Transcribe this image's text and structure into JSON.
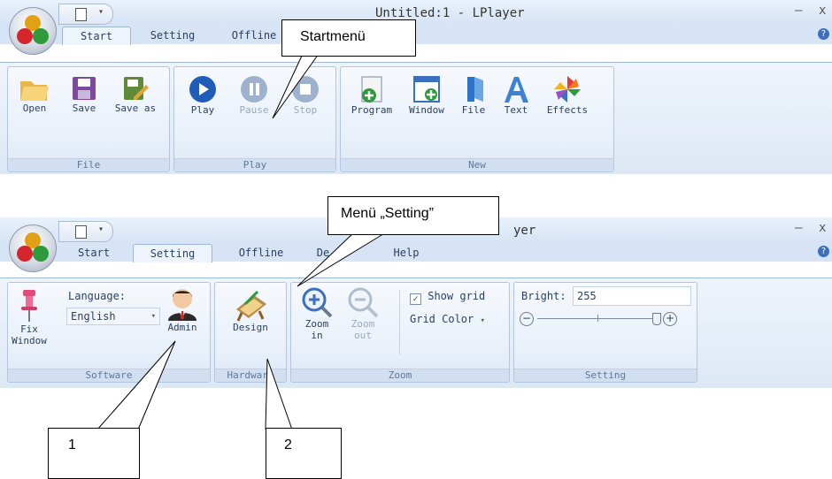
{
  "window1": {
    "title": "Untitled:1 - LPlayer",
    "tabs": [
      "Start",
      "Setting",
      "Offline"
    ],
    "groups": {
      "file": {
        "caption": "File",
        "buttons": [
          "Open",
          "Save",
          "Save as"
        ]
      },
      "play": {
        "caption": "Play",
        "buttons": [
          "Play",
          "Pause",
          "Stop"
        ]
      },
      "new": {
        "caption": "New",
        "buttons": [
          "Program",
          "Window",
          "File",
          "Text",
          "Effects"
        ]
      }
    }
  },
  "window2": {
    "title": "yer",
    "tabs": [
      "Start",
      "Setting",
      "Offline",
      "De",
      "Help"
    ],
    "software": {
      "caption": "Software",
      "fix_window": "Fix Window",
      "language_label": "Language:",
      "language_value": "English",
      "admin": "Admin"
    },
    "hardware": {
      "caption": "Hardware",
      "design": "Design"
    },
    "zoom": {
      "caption": "Zoom",
      "zoom_in": "Zoom in",
      "zoom_out": "Zoom out",
      "show_grid": "Show grid",
      "grid_color": "Grid Color"
    },
    "setting": {
      "caption": "Setting",
      "bright_label": "Bright:",
      "bright_value": "255"
    }
  },
  "window_controls": {
    "minimize": "–",
    "close": "x",
    "help": "?"
  },
  "callouts": {
    "startmenu": "Startmenü",
    "setting_menu": "Menü „Setting”",
    "label1": "1",
    "label2": "2"
  }
}
